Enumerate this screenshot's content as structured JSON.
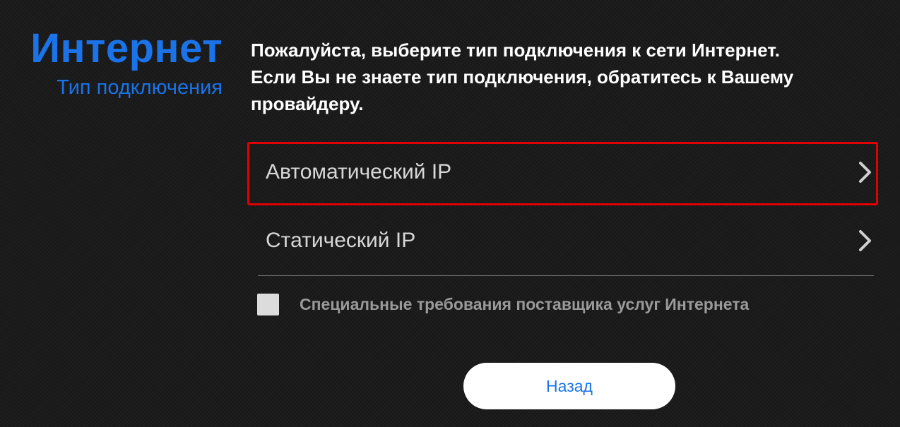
{
  "header": {
    "title": "Интернет",
    "subtitle": "Тип подключения",
    "accent_color": "#1a73e8"
  },
  "prompt": {
    "line1": "Пожалуйста, выберите тип подключения к сети Интернет.",
    "line2": "Если Вы не знаете тип подключения, обратитесь к Вашему",
    "line3": "провайдеру."
  },
  "options": [
    {
      "label": "Автоматический IP",
      "icon": "chevron-right-icon",
      "highlighted": true,
      "highlight_color": "#e00000"
    },
    {
      "label": "Статический IP",
      "icon": "chevron-right-icon",
      "highlighted": false
    }
  ],
  "isp_requirements": {
    "label": "Специальные требования поставщика услуг Интернета",
    "checked": false
  },
  "back_button": {
    "label": "Назад",
    "text_color": "#1a73e8"
  }
}
